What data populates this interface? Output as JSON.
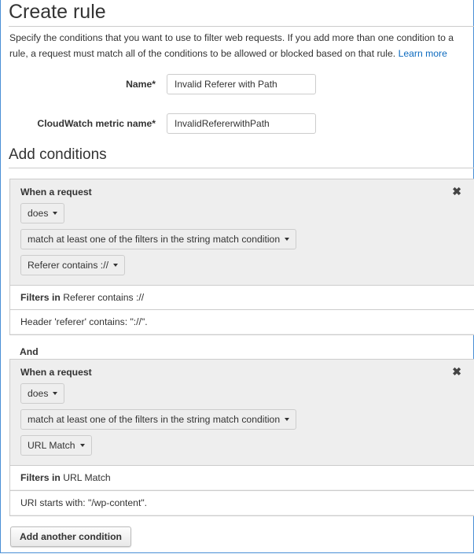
{
  "page": {
    "title": "Create rule",
    "description": "Specify the conditions that you want to use to filter web requests. If you add more than one condition to a rule, a request must match all of the conditions to be allowed or blocked based on that rule.",
    "learn_more": "Learn more"
  },
  "form": {
    "name_label": "Name*",
    "name_value": "Invalid Referer with Path",
    "metric_label": "CloudWatch metric name*",
    "metric_value": "InvalidRefererwithPath"
  },
  "conditions_section": {
    "title": "Add conditions",
    "and_label": "And",
    "add_button": "Add another condition",
    "close_icon": "close-icon"
  },
  "conditions": [
    {
      "heading": "When a request",
      "does": "does",
      "match_type": "match at least one of the filters in the string match condition",
      "condition_name": "Referer contains ://",
      "filters_prefix": "Filters in",
      "filters_name": "Referer contains ://",
      "filter_detail": "Header 'referer' contains: \"://\"."
    },
    {
      "heading": "When a request",
      "does": "does",
      "match_type": "match at least one of the filters in the string match condition",
      "condition_name": "URL Match",
      "filters_prefix": "Filters in",
      "filters_name": "URL Match",
      "filter_detail": "URI starts with: \"/wp-content\"."
    }
  ],
  "colors": {
    "link": "#0d6bbf",
    "panel_bg": "#eeeeee",
    "frame_border": "#4a8fd6"
  }
}
